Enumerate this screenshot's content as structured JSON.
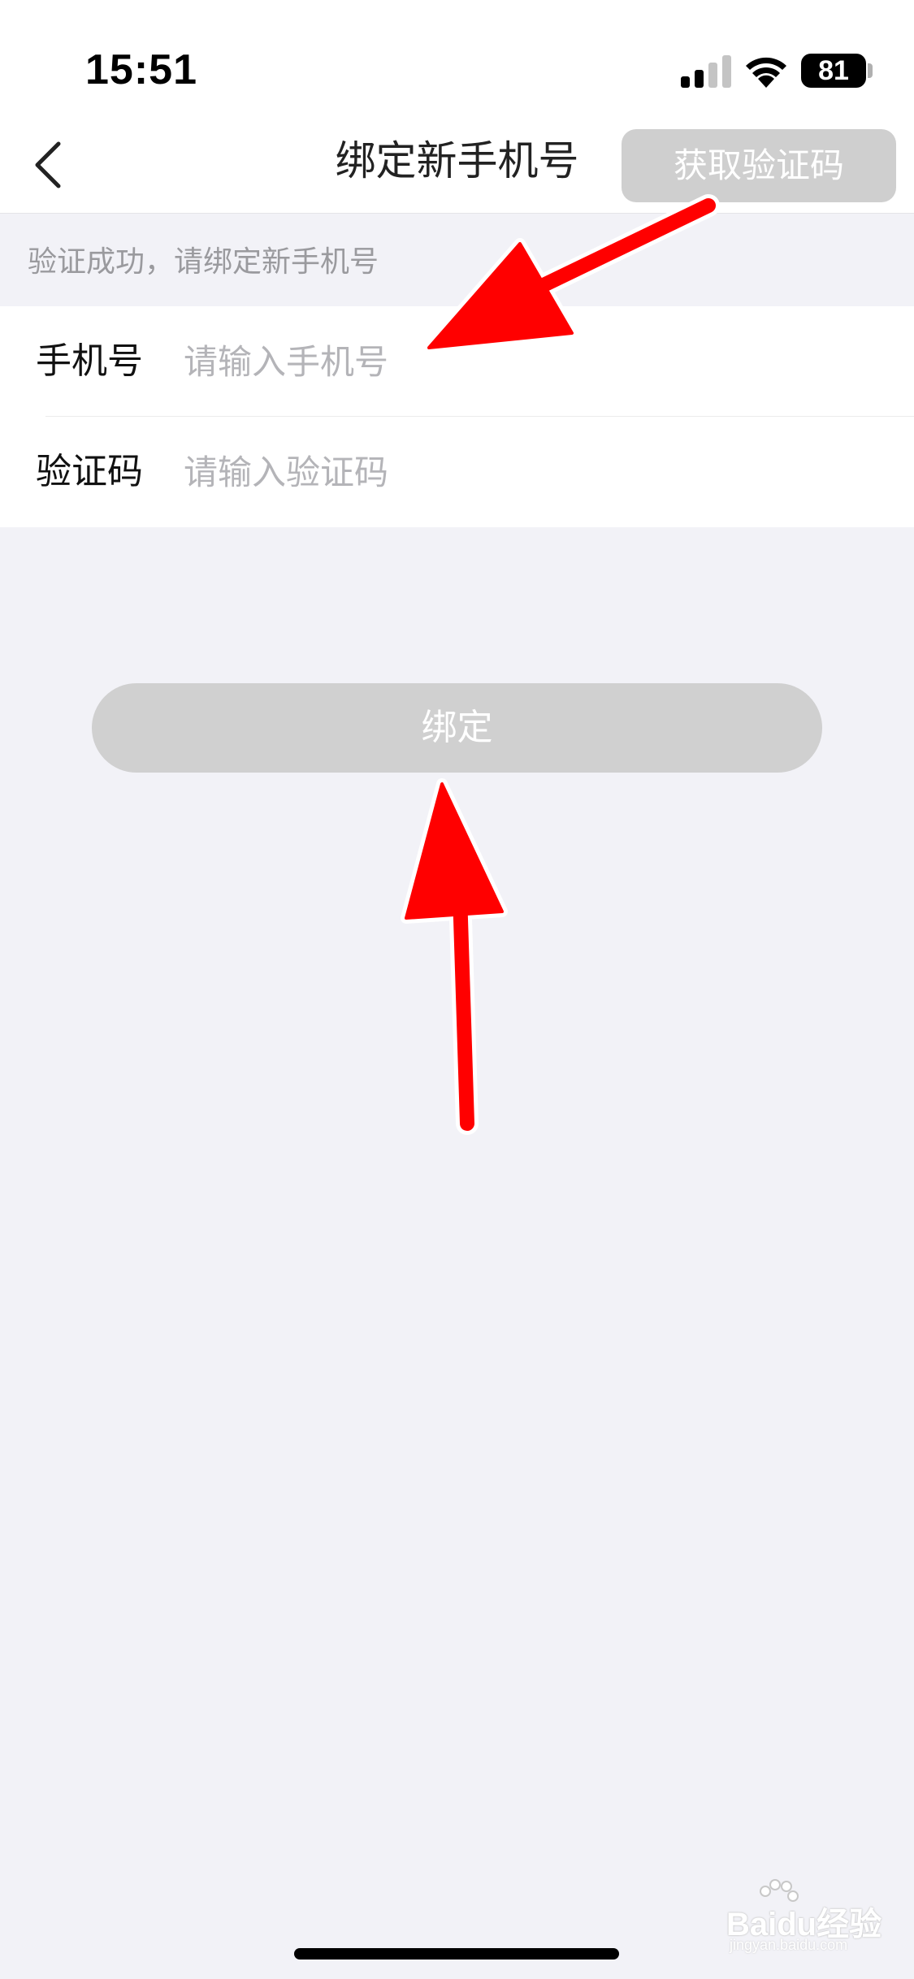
{
  "status_bar": {
    "time": "15:51",
    "battery": "81",
    "icons": [
      "signal-icon",
      "wifi-icon",
      "battery-icon"
    ]
  },
  "nav": {
    "title": "绑定新手机号",
    "back_icon": "chevron-left-icon"
  },
  "hint": "验证成功，请绑定新手机号",
  "form": {
    "phone": {
      "label": "手机号",
      "value": "",
      "placeholder": "请输入手机号"
    },
    "code": {
      "label": "验证码",
      "value": "",
      "placeholder": "请输入验证码",
      "button_label": "获取验证码"
    }
  },
  "bind_button": {
    "label": "绑定"
  },
  "watermark": {
    "text": "Baidu经验",
    "subtext": "jingyan.baidu.com"
  },
  "colors": {
    "page_background": "#f2f2f7",
    "disabled_button": "#d0d0d0",
    "placeholder": "#b4b4b8",
    "hint_text": "#9a9a9e",
    "annotation_arrow": "#ff0000"
  }
}
